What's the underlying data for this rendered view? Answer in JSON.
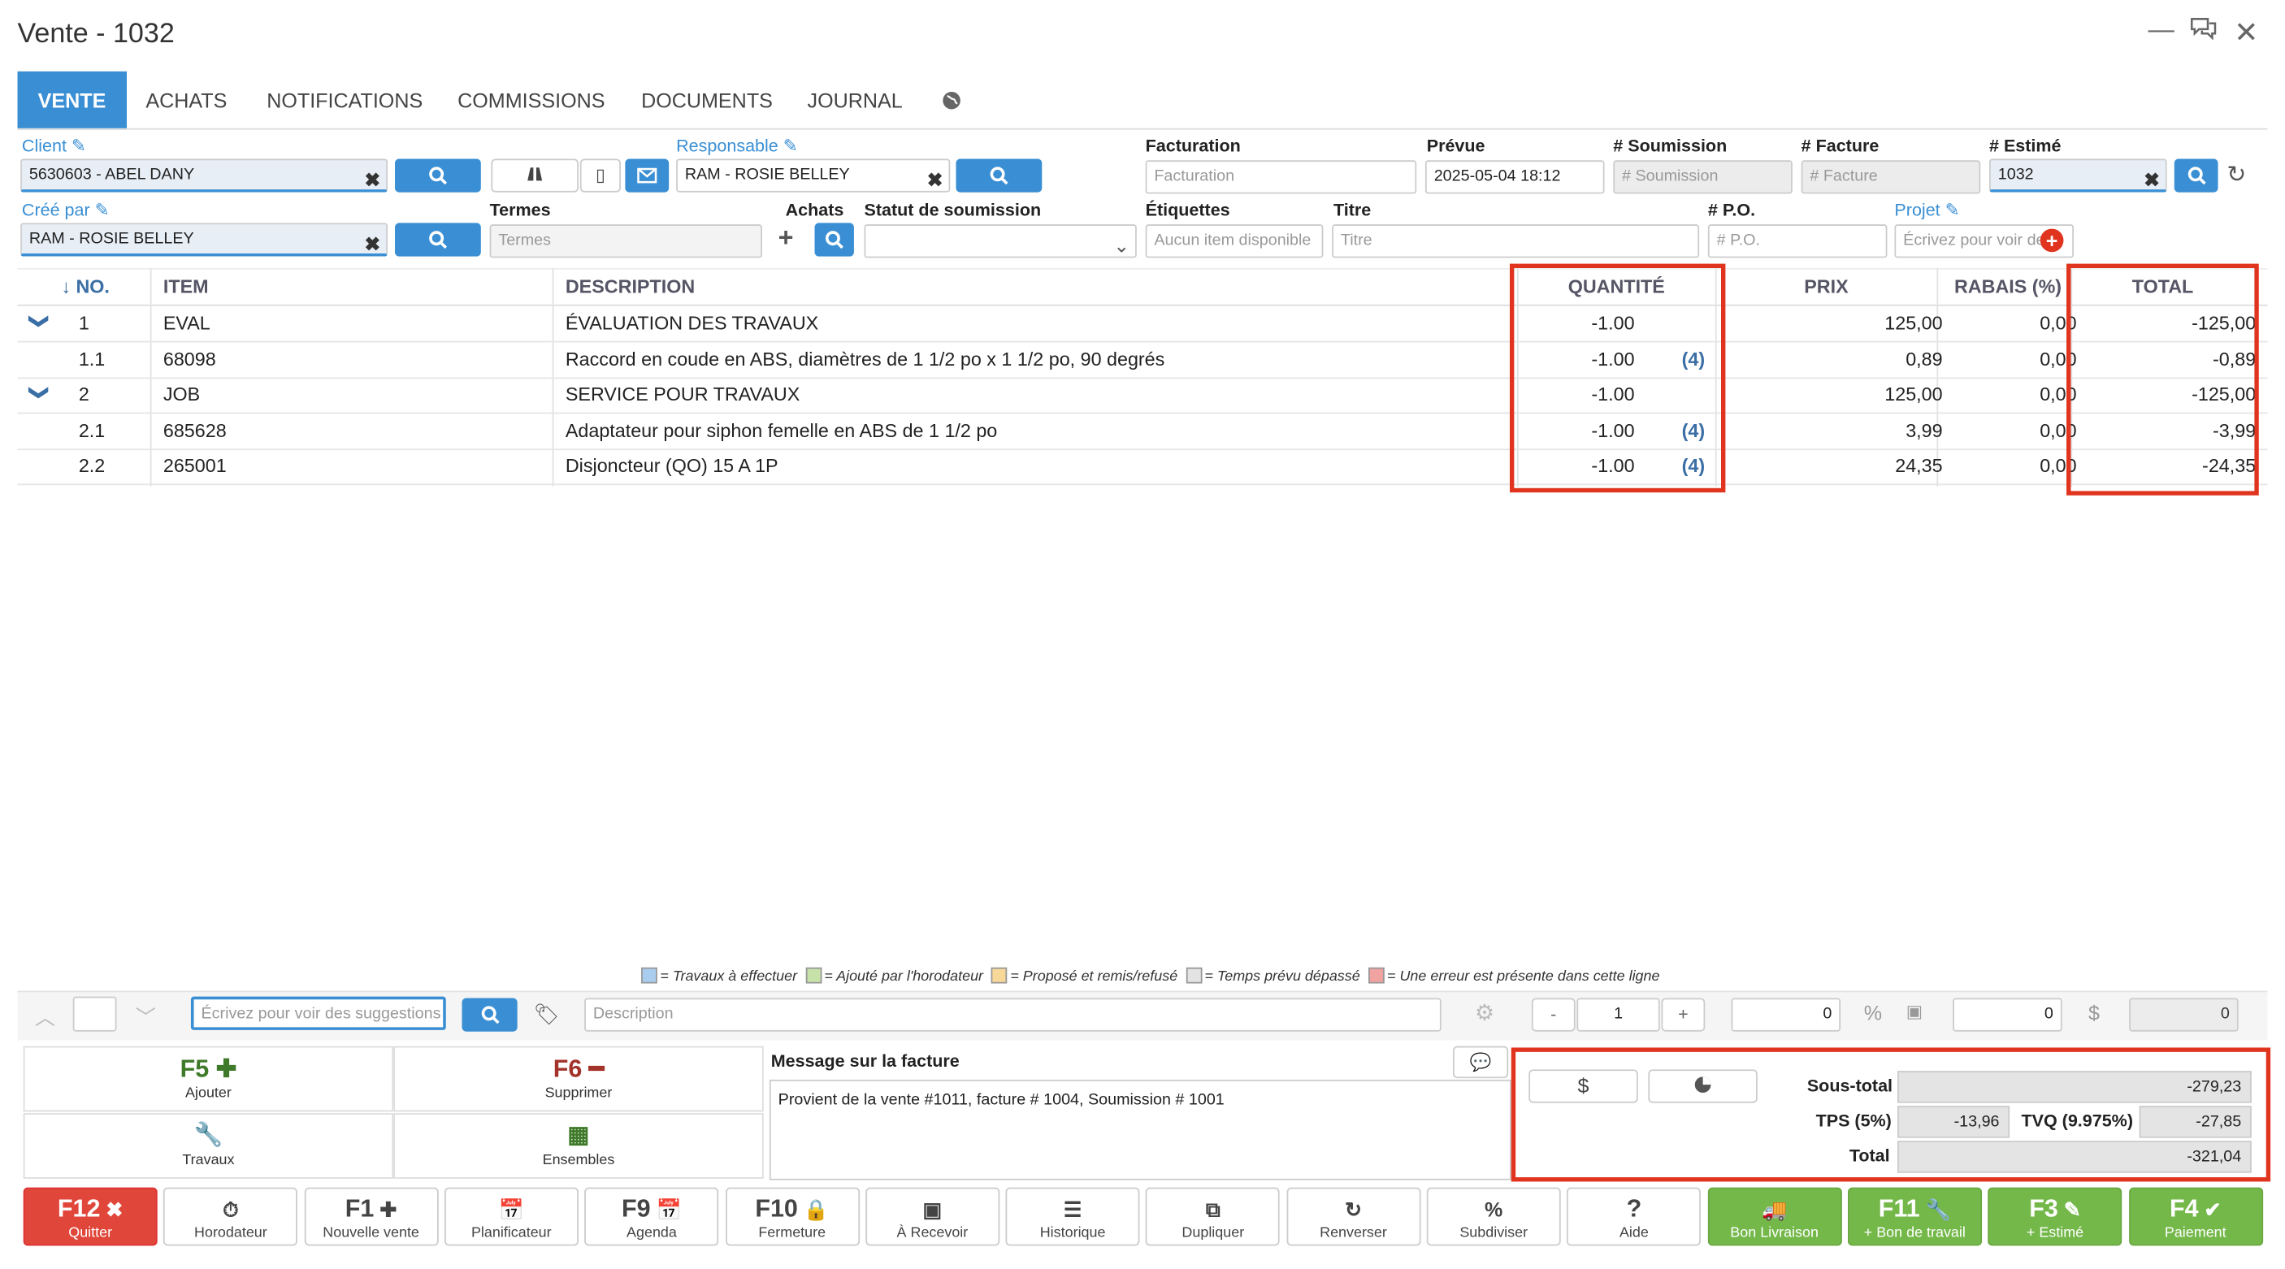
{
  "window": {
    "title": "Vente - 1032"
  },
  "tabs": [
    "VENTE",
    "ACHATS",
    "NOTIFICATIONS",
    "COMMISSIONS",
    "DOCUMENTS",
    "JOURNAL"
  ],
  "form": {
    "client_label": "Client",
    "client_value": "5630603 - ABEL DANY",
    "responsable_label": "Responsable",
    "responsable_value": "RAM - ROSIE BELLEY",
    "cree_label": "Créé par",
    "cree_value": "RAM - ROSIE BELLEY",
    "termes_label": "Termes",
    "termes_ph": "Termes",
    "achats_label": "Achats",
    "statut_label": "Statut de soumission",
    "facturation_label": "Facturation",
    "facturation_ph": "Facturation",
    "prevue_label": "Prévue",
    "prevue_value": "2025-05-04 18:12",
    "soumission_label": "# Soumission",
    "soumission_ph": "# Soumission",
    "facture_label": "# Facture",
    "facture_ph": "# Facture",
    "estime_label": "# Estimé",
    "estime_value": "1032",
    "etiquettes_label": "Étiquettes",
    "etiquettes_ph": "Aucun item disponible",
    "titre_label": "Titre",
    "titre_ph": "Titre",
    "po_label": "# P.O.",
    "po_ph": "# P.O.",
    "projet_label": "Projet",
    "projet_ph": "Écrivez pour voir des"
  },
  "table": {
    "headers": {
      "no": "↓ NO.",
      "item": "ITEM",
      "desc": "DESCRIPTION",
      "qty": "QUANTITÉ",
      "prix": "PRIX",
      "rabais": "RABAIS (%)",
      "total": "TOTAL"
    },
    "rows": [
      {
        "no": "1",
        "item": "EVAL",
        "desc": "ÉVALUATION DES TRAVAUX",
        "qty": "-1.00",
        "badge": "",
        "prix": "125,00",
        "rabais": "0,00",
        "total": "-125,00",
        "chev": "❯"
      },
      {
        "no": "1.1",
        "item": "68098",
        "desc": "Raccord en coude en ABS, diamètres de 1 1/2 po x 1 1/2 po, 90 degrés",
        "qty": "-1.00",
        "badge": "(4)",
        "prix": "0,89",
        "rabais": "0,00",
        "total": "-0,89",
        "chev": ""
      },
      {
        "no": "2",
        "item": "JOB",
        "desc": "SERVICE POUR TRAVAUX",
        "qty": "-1.00",
        "badge": "",
        "prix": "125,00",
        "rabais": "0,00",
        "total": "-125,00",
        "chev": "❯"
      },
      {
        "no": "2.1",
        "item": "685628",
        "desc": "Adaptateur pour siphon femelle en ABS de 1 1/2 po",
        "qty": "-1.00",
        "badge": "(4)",
        "prix": "3,99",
        "rabais": "0,00",
        "total": "-3,99",
        "chev": ""
      },
      {
        "no": "2.2",
        "item": "265001",
        "desc": "Disjoncteur (QO) 15 A 1P",
        "qty": "-1.00",
        "badge": "(4)",
        "prix": "24,35",
        "rabais": "0,00",
        "total": "-24,35",
        "chev": ""
      }
    ]
  },
  "legend": [
    "= Travaux à effectuer",
    "= Ajouté par l'horodateur",
    "= Proposé et remis/refusé",
    "= Temps prévu dépassé",
    "= Une erreur est présente dans cette ligne"
  ],
  "entry": {
    "search_ph": "Écrivez pour voir des suggestions",
    "desc_ph": "Description",
    "qty": "1",
    "v1": "0",
    "v2": "0",
    "v3": "0",
    "minus": "-",
    "plus": "+",
    "pct": "%",
    "dollar": "$"
  },
  "actions": {
    "f5": "F5",
    "f5s": "Ajouter",
    "f6": "F6",
    "f6s": "Supprimer",
    "trav": "Travaux",
    "ens": "Ensembles"
  },
  "message": {
    "label": "Message sur la facture",
    "text": "Provient de la vente #1011, facture # 1004, Soumission # 1001"
  },
  "totals": {
    "dollar": "$",
    "sous_label": "Sous-total",
    "sous": "-279,23",
    "tps_label": "TPS (5%)",
    "tps": "-13,96",
    "tvq_label": "TVQ (9.975%)",
    "tvq": "-27,85",
    "total_label": "Total",
    "total": "-321,04"
  },
  "fkeys": [
    {
      "k": "F12",
      "s": "Quitter"
    },
    {
      "k": "",
      "s": "Horodateur"
    },
    {
      "k": "F1",
      "s": "Nouvelle vente"
    },
    {
      "k": "",
      "s": "Planificateur"
    },
    {
      "k": "F9",
      "s": "Agenda"
    },
    {
      "k": "F10",
      "s": "Fermeture"
    },
    {
      "k": "",
      "s": "À Recevoir"
    },
    {
      "k": "",
      "s": "Historique"
    },
    {
      "k": "",
      "s": "Dupliquer"
    },
    {
      "k": "",
      "s": "Renverser"
    },
    {
      "k": "",
      "s": "Subdiviser"
    },
    {
      "k": "?",
      "s": "Aide"
    },
    {
      "k": "",
      "s": "Bon Livraison"
    },
    {
      "k": "F11",
      "s": "+ Bon de travail"
    },
    {
      "k": "F3",
      "s": "+ Estimé"
    },
    {
      "k": "F4",
      "s": "Paiement"
    }
  ],
  "colors": {
    "accent": "#3a8fd4",
    "red": "#e0341e",
    "green": "#74b84a"
  }
}
